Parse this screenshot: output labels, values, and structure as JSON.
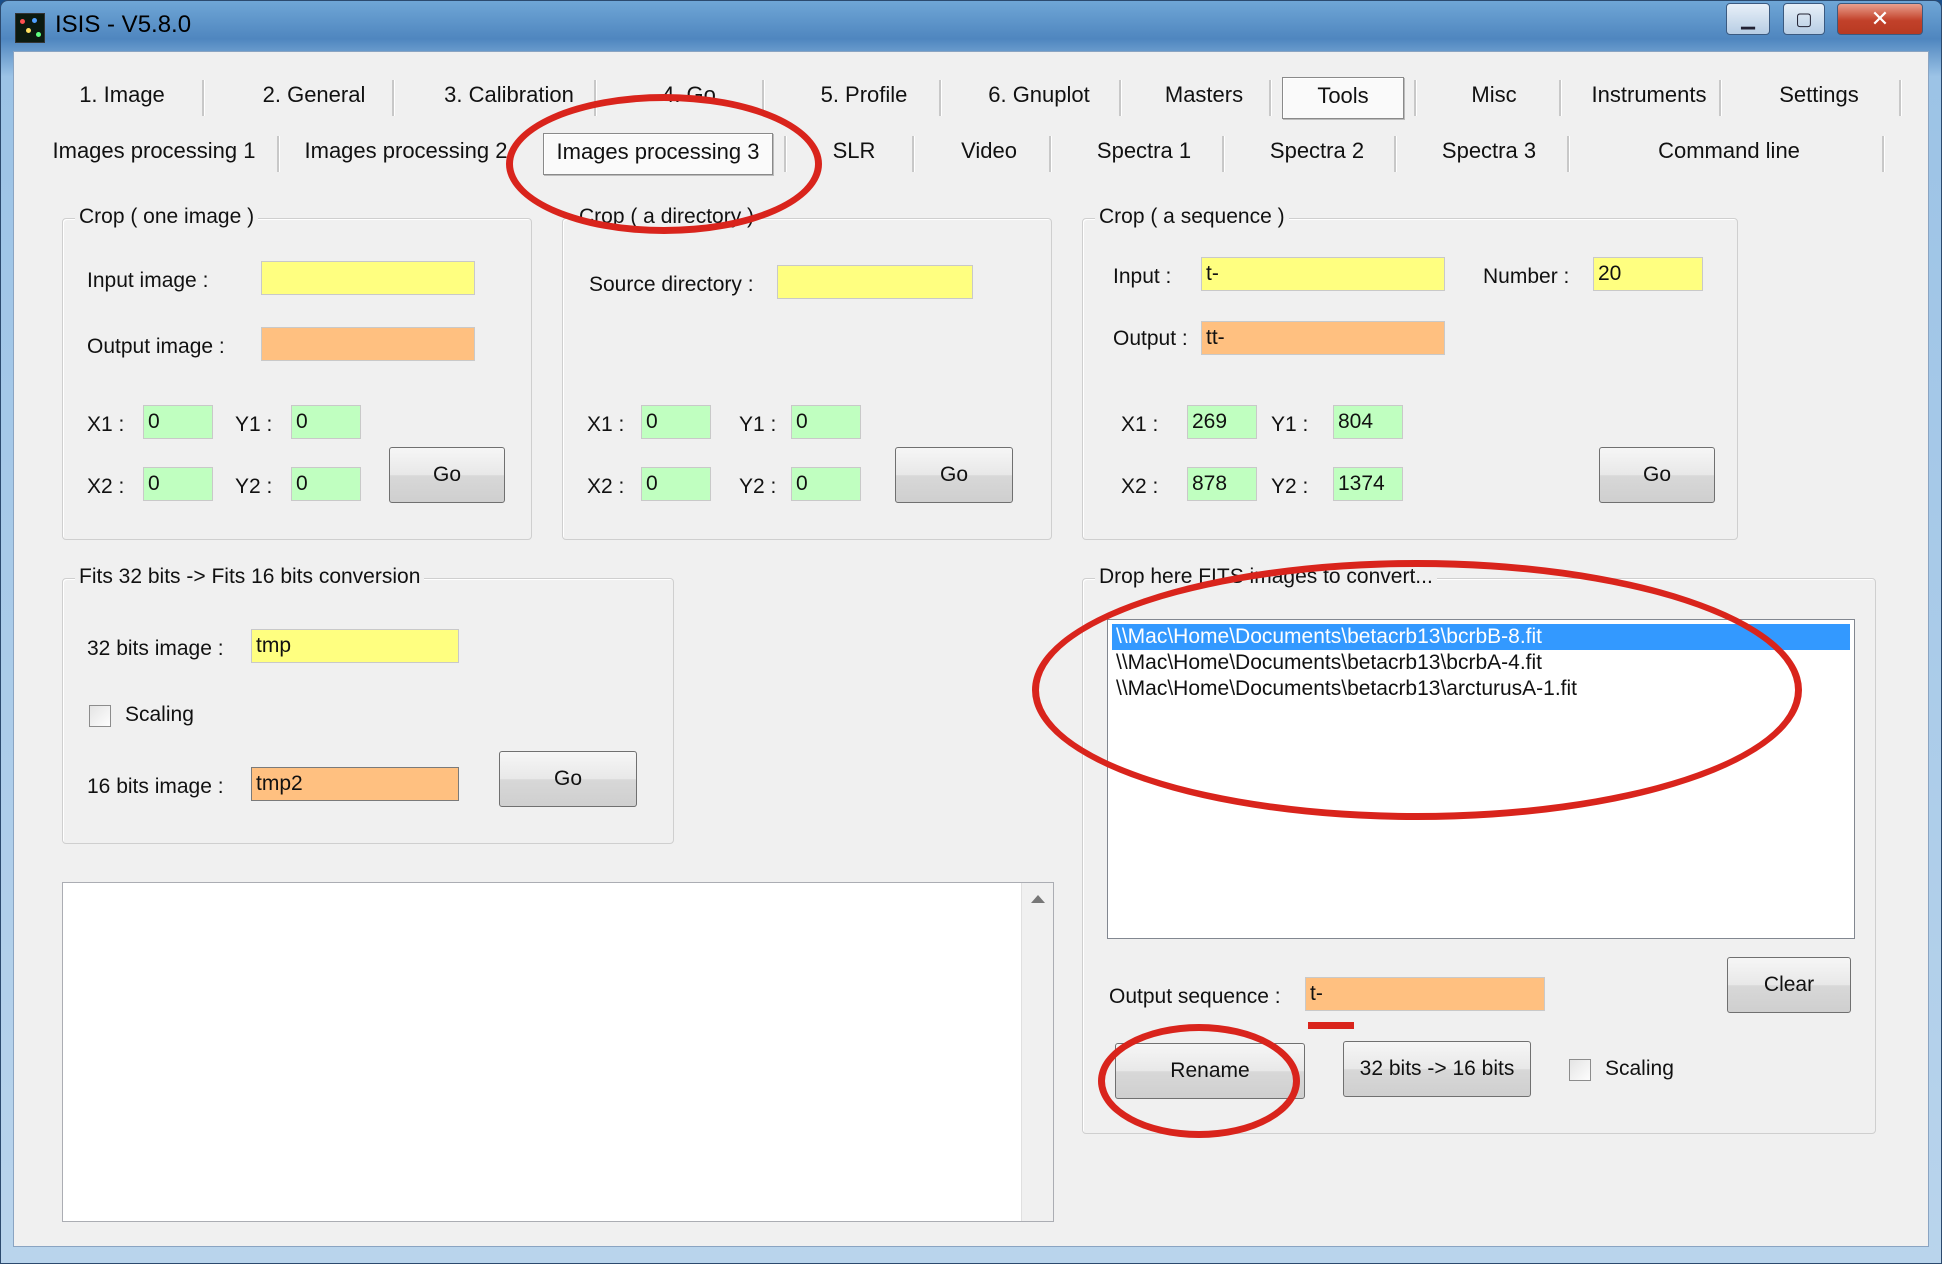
{
  "window": {
    "title": "ISIS - V5.8.0",
    "controls": {
      "minimize": "▁",
      "maximize": "▢",
      "close": "✕"
    }
  },
  "tabs": {
    "row1": [
      "1. Image",
      "2. General",
      "3. Calibration",
      "4. Go",
      "5. Profile",
      "6. Gnuplot",
      "Masters",
      "Tools",
      "Misc",
      "Instruments",
      "Settings"
    ],
    "row2": [
      "Images processing  1",
      "Images processing 2",
      "Images processing 3",
      "SLR",
      "Video",
      "Spectra 1",
      "Spectra 2",
      "Spectra 3",
      "Command line"
    ],
    "selected_row1": "Tools",
    "selected_row2": "Images processing 3"
  },
  "crop_one": {
    "legend": "Crop ( one image )",
    "input_label": "Input image :",
    "input_value": "",
    "output_label": "Output image :",
    "output_value": "",
    "x1_label": "X1 :",
    "x1": "0",
    "y1_label": "Y1 :",
    "y1": "0",
    "x2_label": "X2 :",
    "x2": "0",
    "y2_label": "Y2 :",
    "y2": "0",
    "go": "Go"
  },
  "crop_dir": {
    "legend": "Crop ( a directory )",
    "source_label": "Source directory :",
    "source_value": "",
    "x1_label": "X1 :",
    "x1": "0",
    "y1_label": "Y1 :",
    "y1": "0",
    "x2_label": "X2 :",
    "x2": "0",
    "y2_label": "Y2 :",
    "y2": "0",
    "go": "Go"
  },
  "crop_seq": {
    "legend": "Crop ( a sequence )",
    "input_label": "Input :",
    "input_value": "t-",
    "number_label": "Number :",
    "number_value": "20",
    "output_label": "Output :",
    "output_value": "tt-",
    "x1_label": "X1 :",
    "x1": "269",
    "y1_label": "Y1 :",
    "y1": "804",
    "x2_label": "X2 :",
    "x2": "878",
    "y2_label": "Y2 :",
    "y2": "1374",
    "go": "Go"
  },
  "fits_conv": {
    "legend": "Fits 32 bits -> Fits 16 bits conversion",
    "bits32_label": "32 bits image :",
    "bits32_value": "tmp",
    "scaling_label": "Scaling",
    "bits16_label": "16 bits image :",
    "bits16_value": "tmp2",
    "go": "Go"
  },
  "drop_fits": {
    "legend": "Drop here FITS images to convert...",
    "files": [
      "\\\\Mac\\Home\\Documents\\betacrb13\\bcrbB-8.fit",
      "\\\\Mac\\Home\\Documents\\betacrb13\\bcrbA-4.fit",
      "\\\\Mac\\Home\\Documents\\betacrb13\\arcturusA-1.fit"
    ],
    "selected_index": 0,
    "output_seq_label": "Output sequence :",
    "output_seq_value": "t-",
    "clear": "Clear",
    "rename": "Rename",
    "convert": "32 bits -> 16 bits",
    "scaling_label": "Scaling"
  },
  "colors": {
    "input_yellow": "#ffff80",
    "output_orange": "#ffc080",
    "coord_green": "#c0ffc0",
    "selection_blue": "#3399ff",
    "annotation_red": "#d9241c"
  }
}
